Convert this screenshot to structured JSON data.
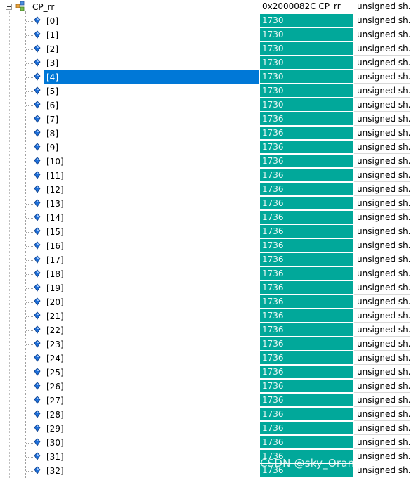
{
  "watch": {
    "root": {
      "name": "CP_rr",
      "value": "0x2000082C CP_rr",
      "type": "unsigned sh..."
    },
    "selected_index": 4,
    "elements": [
      {
        "name": "[0]",
        "value": "1730",
        "type": "unsigned sh..."
      },
      {
        "name": "[1]",
        "value": "1730",
        "type": "unsigned sh..."
      },
      {
        "name": "[2]",
        "value": "1730",
        "type": "unsigned sh..."
      },
      {
        "name": "[3]",
        "value": "1730",
        "type": "unsigned sh..."
      },
      {
        "name": "[4]",
        "value": "1730",
        "type": "unsigned sh..."
      },
      {
        "name": "[5]",
        "value": "1730",
        "type": "unsigned sh..."
      },
      {
        "name": "[6]",
        "value": "1730",
        "type": "unsigned sh..."
      },
      {
        "name": "[7]",
        "value": "1736",
        "type": "unsigned sh..."
      },
      {
        "name": "[8]",
        "value": "1736",
        "type": "unsigned sh..."
      },
      {
        "name": "[9]",
        "value": "1736",
        "type": "unsigned sh..."
      },
      {
        "name": "[10]",
        "value": "1736",
        "type": "unsigned sh..."
      },
      {
        "name": "[11]",
        "value": "1736",
        "type": "unsigned sh..."
      },
      {
        "name": "[12]",
        "value": "1736",
        "type": "unsigned sh..."
      },
      {
        "name": "[13]",
        "value": "1736",
        "type": "unsigned sh..."
      },
      {
        "name": "[14]",
        "value": "1736",
        "type": "unsigned sh..."
      },
      {
        "name": "[15]",
        "value": "1736",
        "type": "unsigned sh..."
      },
      {
        "name": "[16]",
        "value": "1736",
        "type": "unsigned sh..."
      },
      {
        "name": "[17]",
        "value": "1736",
        "type": "unsigned sh..."
      },
      {
        "name": "[18]",
        "value": "1736",
        "type": "unsigned sh..."
      },
      {
        "name": "[19]",
        "value": "1736",
        "type": "unsigned sh..."
      },
      {
        "name": "[20]",
        "value": "1736",
        "type": "unsigned sh..."
      },
      {
        "name": "[21]",
        "value": "1736",
        "type": "unsigned sh..."
      },
      {
        "name": "[22]",
        "value": "1736",
        "type": "unsigned sh..."
      },
      {
        "name": "[23]",
        "value": "1736",
        "type": "unsigned sh..."
      },
      {
        "name": "[24]",
        "value": "1736",
        "type": "unsigned sh..."
      },
      {
        "name": "[25]",
        "value": "1736",
        "type": "unsigned sh..."
      },
      {
        "name": "[26]",
        "value": "1736",
        "type": "unsigned sh..."
      },
      {
        "name": "[27]",
        "value": "1736",
        "type": "unsigned sh..."
      },
      {
        "name": "[28]",
        "value": "1736",
        "type": "unsigned sh..."
      },
      {
        "name": "[29]",
        "value": "1736",
        "type": "unsigned sh..."
      },
      {
        "name": "[30]",
        "value": "1736",
        "type": "unsigned sh..."
      },
      {
        "name": "[31]",
        "value": "1736",
        "type": "unsigned sh..."
      },
      {
        "name": "[32]",
        "value": "1736",
        "type": "unsigned sh..."
      }
    ]
  },
  "colors": {
    "changed_value_bg": "#01a89a",
    "selection": "#0078d7",
    "element_icon": "#1e6fd9"
  },
  "icons": {
    "root": "struct-icon",
    "element": "variable-diamond-icon",
    "expander": "collapse-minus-icon"
  },
  "watermark": "CSDN @sky_Orange_too"
}
